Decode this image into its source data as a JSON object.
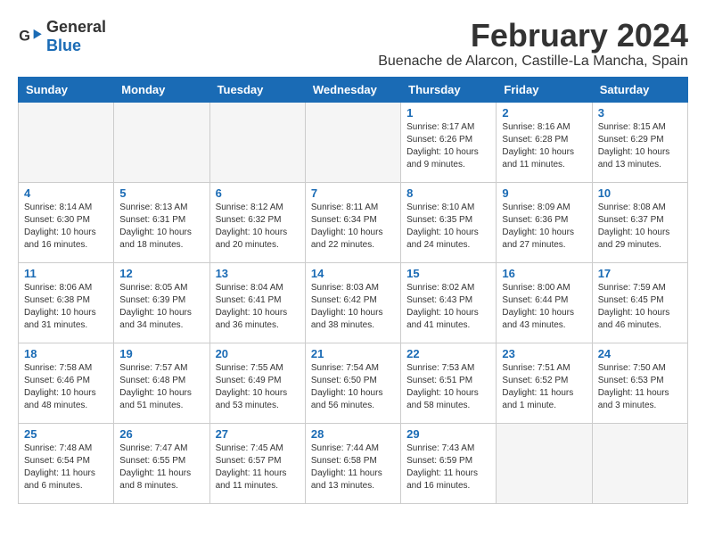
{
  "logo": {
    "text_general": "General",
    "text_blue": "Blue"
  },
  "header": {
    "title": "February 2024",
    "subtitle": "Buenache de Alarcon, Castille-La Mancha, Spain"
  },
  "weekdays": [
    "Sunday",
    "Monday",
    "Tuesday",
    "Wednesday",
    "Thursday",
    "Friday",
    "Saturday"
  ],
  "weeks": [
    [
      {
        "day": "",
        "detail": ""
      },
      {
        "day": "",
        "detail": ""
      },
      {
        "day": "",
        "detail": ""
      },
      {
        "day": "",
        "detail": ""
      },
      {
        "day": "1",
        "detail": "Sunrise: 8:17 AM\nSunset: 6:26 PM\nDaylight: 10 hours\nand 9 minutes."
      },
      {
        "day": "2",
        "detail": "Sunrise: 8:16 AM\nSunset: 6:28 PM\nDaylight: 10 hours\nand 11 minutes."
      },
      {
        "day": "3",
        "detail": "Sunrise: 8:15 AM\nSunset: 6:29 PM\nDaylight: 10 hours\nand 13 minutes."
      }
    ],
    [
      {
        "day": "4",
        "detail": "Sunrise: 8:14 AM\nSunset: 6:30 PM\nDaylight: 10 hours\nand 16 minutes."
      },
      {
        "day": "5",
        "detail": "Sunrise: 8:13 AM\nSunset: 6:31 PM\nDaylight: 10 hours\nand 18 minutes."
      },
      {
        "day": "6",
        "detail": "Sunrise: 8:12 AM\nSunset: 6:32 PM\nDaylight: 10 hours\nand 20 minutes."
      },
      {
        "day": "7",
        "detail": "Sunrise: 8:11 AM\nSunset: 6:34 PM\nDaylight: 10 hours\nand 22 minutes."
      },
      {
        "day": "8",
        "detail": "Sunrise: 8:10 AM\nSunset: 6:35 PM\nDaylight: 10 hours\nand 24 minutes."
      },
      {
        "day": "9",
        "detail": "Sunrise: 8:09 AM\nSunset: 6:36 PM\nDaylight: 10 hours\nand 27 minutes."
      },
      {
        "day": "10",
        "detail": "Sunrise: 8:08 AM\nSunset: 6:37 PM\nDaylight: 10 hours\nand 29 minutes."
      }
    ],
    [
      {
        "day": "11",
        "detail": "Sunrise: 8:06 AM\nSunset: 6:38 PM\nDaylight: 10 hours\nand 31 minutes."
      },
      {
        "day": "12",
        "detail": "Sunrise: 8:05 AM\nSunset: 6:39 PM\nDaylight: 10 hours\nand 34 minutes."
      },
      {
        "day": "13",
        "detail": "Sunrise: 8:04 AM\nSunset: 6:41 PM\nDaylight: 10 hours\nand 36 minutes."
      },
      {
        "day": "14",
        "detail": "Sunrise: 8:03 AM\nSunset: 6:42 PM\nDaylight: 10 hours\nand 38 minutes."
      },
      {
        "day": "15",
        "detail": "Sunrise: 8:02 AM\nSunset: 6:43 PM\nDaylight: 10 hours\nand 41 minutes."
      },
      {
        "day": "16",
        "detail": "Sunrise: 8:00 AM\nSunset: 6:44 PM\nDaylight: 10 hours\nand 43 minutes."
      },
      {
        "day": "17",
        "detail": "Sunrise: 7:59 AM\nSunset: 6:45 PM\nDaylight: 10 hours\nand 46 minutes."
      }
    ],
    [
      {
        "day": "18",
        "detail": "Sunrise: 7:58 AM\nSunset: 6:46 PM\nDaylight: 10 hours\nand 48 minutes."
      },
      {
        "day": "19",
        "detail": "Sunrise: 7:57 AM\nSunset: 6:48 PM\nDaylight: 10 hours\nand 51 minutes."
      },
      {
        "day": "20",
        "detail": "Sunrise: 7:55 AM\nSunset: 6:49 PM\nDaylight: 10 hours\nand 53 minutes."
      },
      {
        "day": "21",
        "detail": "Sunrise: 7:54 AM\nSunset: 6:50 PM\nDaylight: 10 hours\nand 56 minutes."
      },
      {
        "day": "22",
        "detail": "Sunrise: 7:53 AM\nSunset: 6:51 PM\nDaylight: 10 hours\nand 58 minutes."
      },
      {
        "day": "23",
        "detail": "Sunrise: 7:51 AM\nSunset: 6:52 PM\nDaylight: 11 hours\nand 1 minute."
      },
      {
        "day": "24",
        "detail": "Sunrise: 7:50 AM\nSunset: 6:53 PM\nDaylight: 11 hours\nand 3 minutes."
      }
    ],
    [
      {
        "day": "25",
        "detail": "Sunrise: 7:48 AM\nSunset: 6:54 PM\nDaylight: 11 hours\nand 6 minutes."
      },
      {
        "day": "26",
        "detail": "Sunrise: 7:47 AM\nSunset: 6:55 PM\nDaylight: 11 hours\nand 8 minutes."
      },
      {
        "day": "27",
        "detail": "Sunrise: 7:45 AM\nSunset: 6:57 PM\nDaylight: 11 hours\nand 11 minutes."
      },
      {
        "day": "28",
        "detail": "Sunrise: 7:44 AM\nSunset: 6:58 PM\nDaylight: 11 hours\nand 13 minutes."
      },
      {
        "day": "29",
        "detail": "Sunrise: 7:43 AM\nSunset: 6:59 PM\nDaylight: 11 hours\nand 16 minutes."
      },
      {
        "day": "",
        "detail": ""
      },
      {
        "day": "",
        "detail": ""
      }
    ]
  ]
}
